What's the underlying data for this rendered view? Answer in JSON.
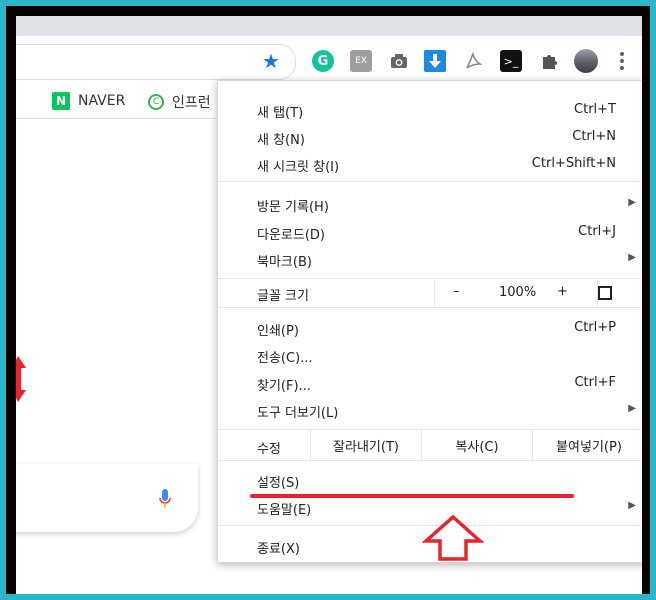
{
  "bookmarks": [
    {
      "logo": "N",
      "label": "NAVER"
    },
    {
      "logo": "C",
      "label": "인프런"
    }
  ],
  "extensions": {
    "grammarly": "G",
    "ex": "EX",
    "terminal": ">_"
  },
  "menu": {
    "new_tab": {
      "label": "새 탭(T)",
      "shortcut": "Ctrl+T"
    },
    "new_window": {
      "label": "새 창(N)",
      "shortcut": "Ctrl+N"
    },
    "incognito": {
      "label": "새 시크릿 창(I)",
      "shortcut": "Ctrl+Shift+N"
    },
    "history": {
      "label": "방문 기록(H)"
    },
    "downloads": {
      "label": "다운로드(D)",
      "shortcut": "Ctrl+J"
    },
    "bookmarks": {
      "label": "북마크(B)"
    },
    "zoom": {
      "label": "글꼴 크기",
      "minus": "–",
      "value": "100%",
      "plus": "+"
    },
    "print": {
      "label": "인쇄(P)",
      "shortcut": "Ctrl+P"
    },
    "cast": {
      "label": "전송(C)..."
    },
    "find": {
      "label": "찾기(F)...",
      "shortcut": "Ctrl+F"
    },
    "more_tools": {
      "label": "도구 더보기(L)"
    },
    "edit": {
      "label": "수정",
      "cut": "잘라내기(T)",
      "copy": "복사(C)",
      "paste": "붙여넣기(P)"
    },
    "settings": {
      "label": "설정(S)"
    },
    "help": {
      "label": "도움말(E)"
    },
    "exit": {
      "label": "종료(X)"
    }
  },
  "colors": {
    "frame": "#29b7c9",
    "annotation": "#e5252a",
    "accent": "#1a73e8"
  }
}
